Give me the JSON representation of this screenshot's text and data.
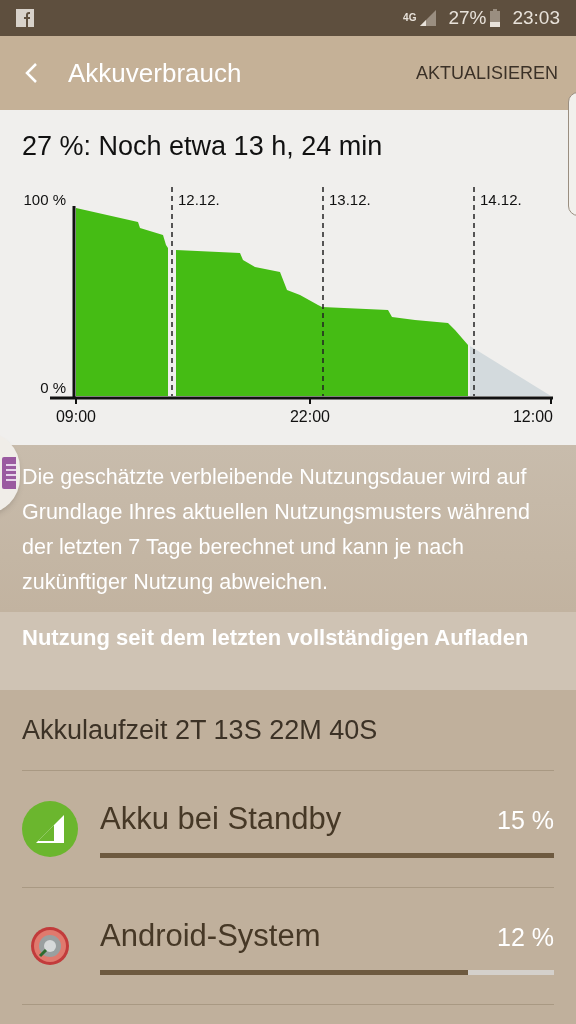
{
  "status_bar": {
    "network": "4G",
    "battery": "27%",
    "time": "23:03"
  },
  "header": {
    "title": "Akkuverbrauch",
    "action": "AKTUALISIEREN"
  },
  "summary": "27 %: Noch etwa 13 h, 24 min",
  "battery_chart": {
    "y_labels": [
      "100 %",
      "0 %"
    ],
    "x_labels": [
      "09:00",
      "22:00",
      "12:00"
    ],
    "day_markers": [
      "12.12.",
      "13.12.",
      "14.12."
    ]
  },
  "description": "Die geschätzte verbleibende Nutzungsdauer wird auf Grundlage Ihres aktuellen Nutzungsmusters während der letzten 7 Tage berechnet und kann je nach zukünftiger Nutzung abweichen.",
  "section_title": "Nutzung seit dem letzten vollständigen Aufladen",
  "runtime": "Akkulaufzeit 2T 13S 22M 40S",
  "apps": [
    {
      "kind": "standby",
      "name": "Akku bei Standby",
      "percent": "15 %",
      "level": 1.0
    },
    {
      "kind": "system",
      "name": "Android-System",
      "percent": "12 %",
      "level": 0.81
    }
  ]
}
